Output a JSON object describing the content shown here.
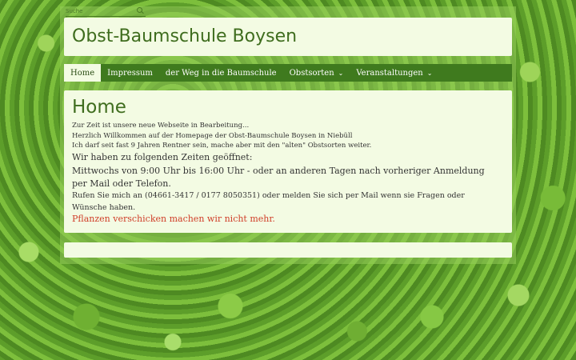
{
  "search": {
    "placeholder": "Suche"
  },
  "header": {
    "title": "Obst-Baumschule Boysen"
  },
  "nav": {
    "items": [
      {
        "label": "Home",
        "active": true
      },
      {
        "label": "Impressum"
      },
      {
        "label": "der Weg in die Baumschule"
      },
      {
        "label": "Obstsorten",
        "dropdown": true
      },
      {
        "label": "Veranstaltungen",
        "dropdown": true
      }
    ]
  },
  "main": {
    "title": "Home",
    "line1": "Zur Zeit ist unsere neue Webseite in Bearbeitung...",
    "line2": "Herzlich Willkommen auf der Homepage der Obst-Baumschule Boysen in Niebüll",
    "line3": "Ich darf seit fast 9 Jahren Rentner sein, mache aber mit den \"alten\" Obstsorten weiter.",
    "hours_heading": "Wir haben zu folgenden Zeiten geöffnet:",
    "hours_text": "Mittwochs von 9:00 Uhr bis 16:00 Uhr - oder an anderen Tagen  nach vorheriger Anmeldung per Mail oder Telefon.",
    "contact_text": "Rufen Sie mich an (04661-3417 / 0177 8050351) oder melden Sie sich per Mail wenn sie Fragen oder Wünsche haben.",
    "notice": "Pflanzen verschicken machen wir nicht mehr."
  },
  "colors": {
    "accent": "#3f7a1e",
    "panel": "#f3fbe3",
    "notice": "#d0402a"
  }
}
